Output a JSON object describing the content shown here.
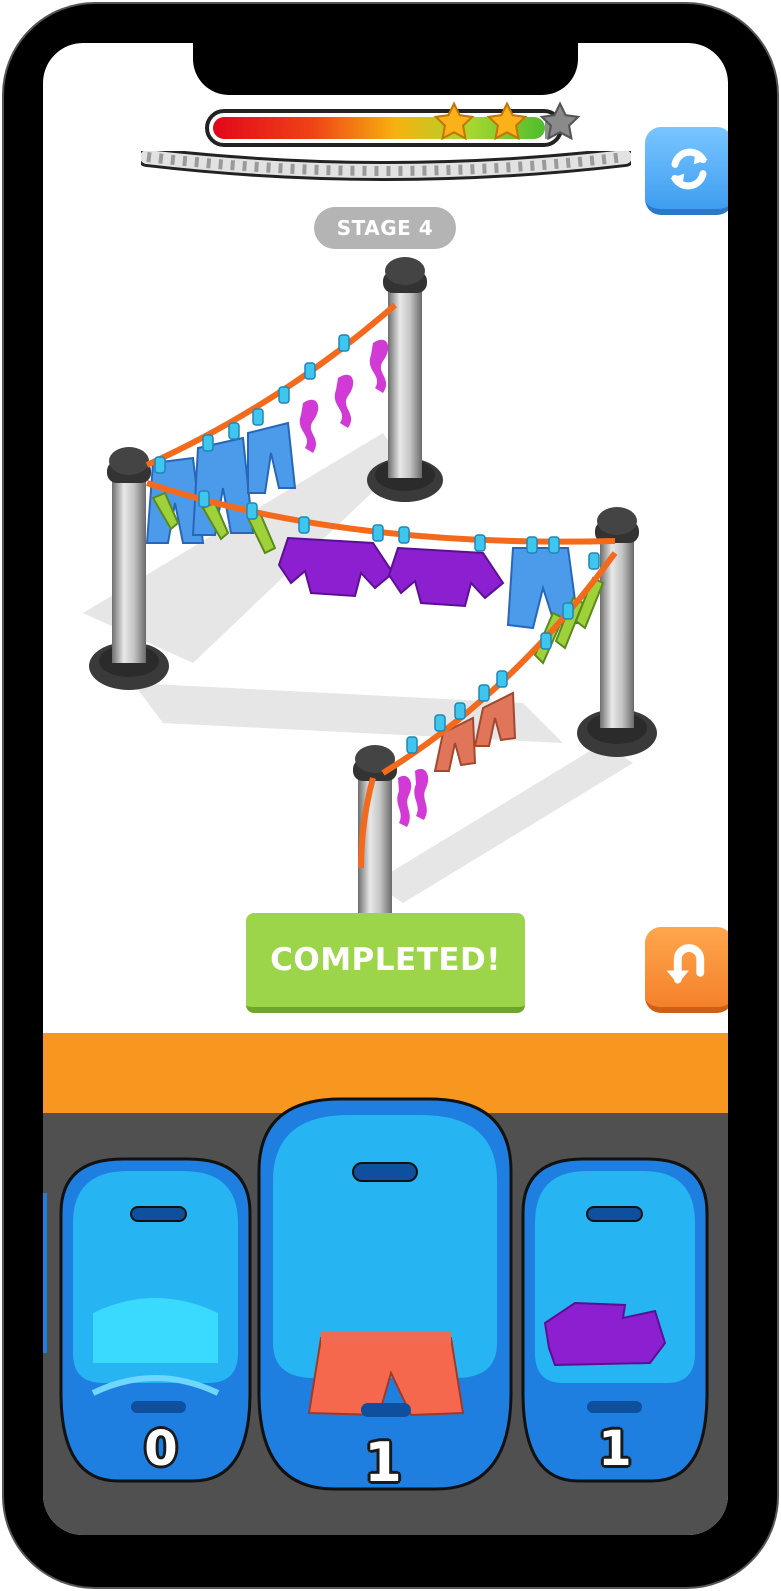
{
  "game": {
    "stage_label": "STAGE 4",
    "progress": {
      "fraction": 0.97,
      "stars_earned": 2,
      "stars_total": 3
    },
    "completed_label": "COMPLETED!",
    "buttons": {
      "restart_icon": "refresh-icon",
      "undo_icon": "undo-icon"
    },
    "baskets": [
      {
        "count": "0",
        "contents": ""
      },
      {
        "count": "1",
        "contents": "shorts"
      },
      {
        "count": "1",
        "contents": "shirt"
      }
    ]
  },
  "colors": {
    "accent_blue": "#4aa8f5",
    "undo_orange": "#f68a2c",
    "completed_green": "#9dd54a",
    "band_orange": "#f8971f",
    "tray_gray": "#505050",
    "stage_pill": "#b4b4b4",
    "clothesline": "#f46a1c",
    "pin_blue": "#3ec6ef"
  }
}
